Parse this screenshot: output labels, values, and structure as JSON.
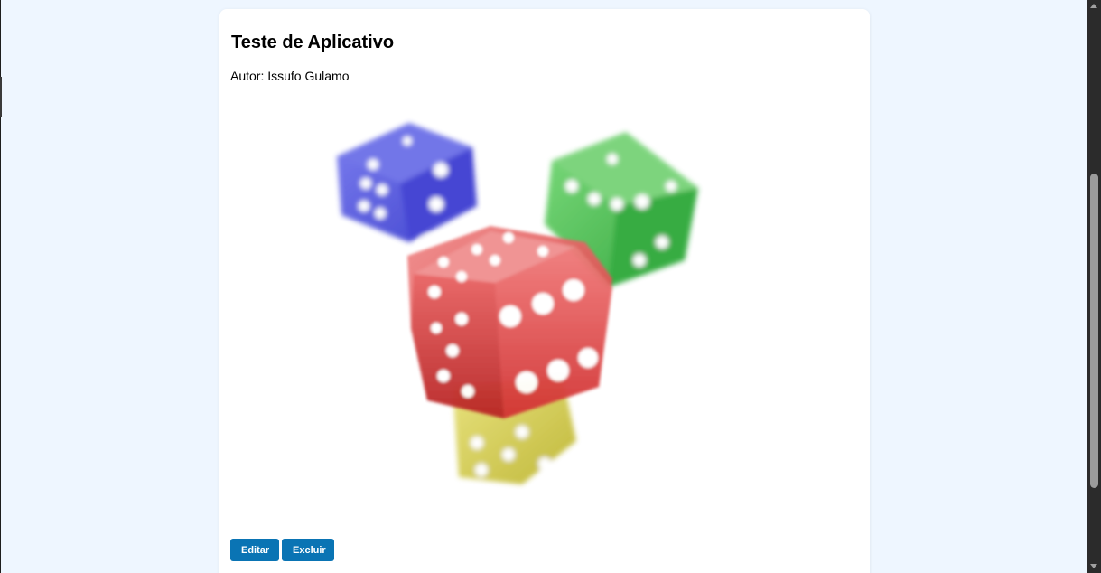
{
  "card": {
    "title": "Teste de Aplicativo",
    "author": "Autor: Issufo Gulamo",
    "image_subject": "four-dice-image",
    "buttons": {
      "edit_label": "Editar",
      "delete_label": "Excluir"
    }
  },
  "colors": {
    "page_background": "#eef6ff",
    "card_background": "#ffffff",
    "button_primary": "#0a74b4",
    "dice_red": "#e24848",
    "dice_blue": "#3c3fd6",
    "dice_green": "#2fb23a",
    "dice_yellow": "#cfc623"
  }
}
